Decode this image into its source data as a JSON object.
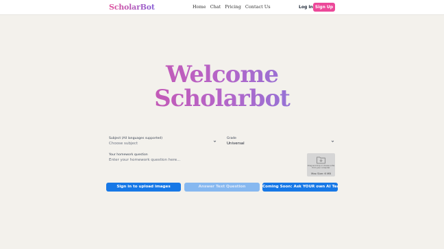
{
  "nav": {
    "logo": "ScholarBot",
    "links": [
      "Home",
      "Chat",
      "Pricing",
      "Contact Us"
    ],
    "login": "Log In",
    "signup": "Sign Up"
  },
  "hero": {
    "line1": "Welcome",
    "line2": "Scholarbot"
  },
  "form": {
    "subject": {
      "label": "Subject (All languages supported)",
      "value": "Choose subject"
    },
    "grade": {
      "label": "Grade",
      "value": "Universal"
    },
    "question": {
      "label": "Your homework question",
      "placeholder": "Enter your homework question here..."
    },
    "upload": {
      "text": "Drag and drop or choose a file from your computer",
      "max_size": "Max Size: 6 MB"
    }
  },
  "actions": {
    "signin_upload": "Sign in to upload images",
    "answer": "Answer Text Question",
    "coming_soon": "Coming Soon: Ask YOUR own AI Teacher"
  },
  "colors": {
    "background": "#f3f1ec",
    "brand_pink": "#ec4899",
    "primary_blue": "#1778e6",
    "disabled_blue": "#86b8f0"
  },
  "icons": {
    "dropdown": "chevron-down-icon",
    "upload": "folder-plus-icon"
  }
}
